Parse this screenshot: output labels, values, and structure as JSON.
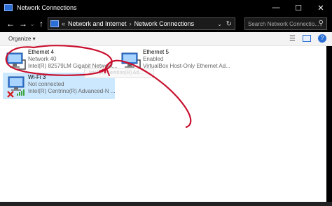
{
  "window": {
    "title": "Network Connections",
    "controls": {
      "minimize": "—",
      "maximize": "☐",
      "close": "✕"
    }
  },
  "nav": {
    "back": "←",
    "forward": "→",
    "recent": "⌄",
    "up": "↑",
    "breadcrumb_sep": "«",
    "crumbs": [
      "Network and Internet",
      "Network Connections"
    ],
    "crumb_sep": "›",
    "dropdown": "⌄",
    "refresh": "↻",
    "search_placeholder": "Search Network Connectio..."
  },
  "toolbar": {
    "organize": "Organize ▾"
  },
  "connections": [
    {
      "name": "Ethernet 4",
      "status": "Network 40",
      "device": "Intel(R) 82579LM Gigabit Network...",
      "selected": false,
      "disconnected": false
    },
    {
      "name": "Ethernet 5",
      "status": "Enabled",
      "device": "VirtualBox Host-Only Ethernet Ad...",
      "selected": false,
      "disconnected": false
    },
    {
      "name": "Wi-Fi 3",
      "status": "Not connected",
      "device": "Intel(R) Centrino(R) Advanced-N ...",
      "selected": true,
      "disconnected": true
    }
  ],
  "tooltip": "Intel(R) Centrino(R) Ad...",
  "colors": {
    "annotation": "#c8102e",
    "selection": "#cce8ff",
    "accent": "#2b6fd6"
  }
}
